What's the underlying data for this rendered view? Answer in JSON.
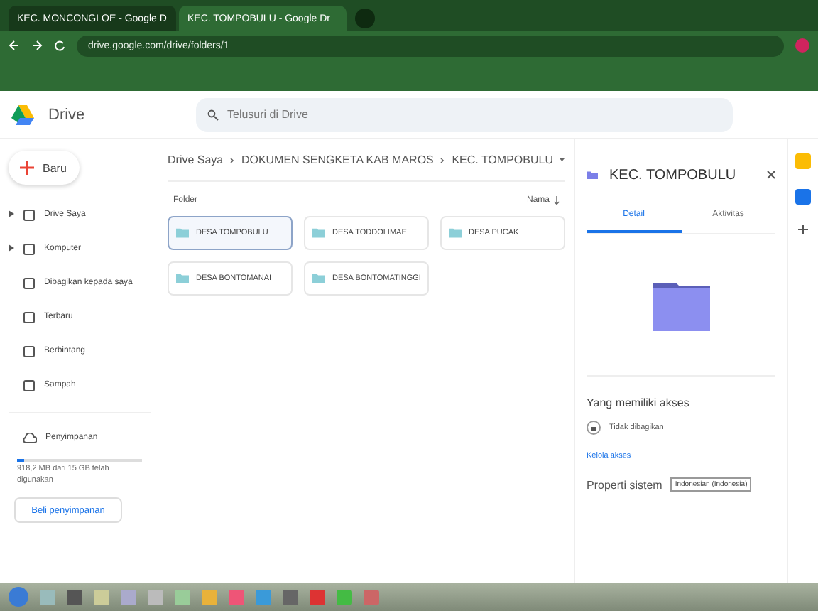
{
  "browser": {
    "tabs": [
      {
        "label": "KEC. MONCONGLOE - Google D",
        "selected": false
      },
      {
        "label": "KEC. TOMPOBULU - Google Dr",
        "selected": true
      }
    ],
    "url": "drive.google.com/drive/folders/1"
  },
  "drive": {
    "brand": "Drive",
    "search": {
      "placeholder": "Telusuri di Drive"
    }
  },
  "sidebar": {
    "new_button": "Baru",
    "items": [
      {
        "label": "Drive Saya",
        "expandable": true
      },
      {
        "label": "Komputer",
        "expandable": true
      },
      {
        "label": "Dibagikan kepada saya",
        "expandable": false
      },
      {
        "label": "Terbaru",
        "expandable": false
      },
      {
        "label": "Berbintang",
        "expandable": false
      },
      {
        "label": "Sampah",
        "expandable": false
      }
    ],
    "storage": {
      "label": "Penyimpanan",
      "level": 0.06,
      "usage": "918,2 MB dari 15 GB telah digunakan",
      "buy": "Beli penyimpanan"
    }
  },
  "breadcrumb": [
    "Drive Saya",
    "DOKUMEN SENGKETA KAB MAROS",
    "KEC. TOMPOBULU"
  ],
  "folders_heading": "Folder",
  "sort": "Nama",
  "folders": [
    {
      "name": "DESA TOMPOBULU",
      "selected": true
    },
    {
      "name": "DESA TODDOLIMAE",
      "selected": false
    },
    {
      "name": "DESA PUCAK",
      "selected": false
    },
    {
      "name": "DESA BONTOMANAI",
      "selected": false
    },
    {
      "name": "DESA BONTOMATINGGI",
      "selected": false
    }
  ],
  "details": {
    "title": "KEC. TOMPOBULU",
    "tabs": [
      {
        "label": "Detail",
        "selected": true
      },
      {
        "label": "Aktivitas",
        "selected": false
      }
    ],
    "access_heading": "Yang memiliki akses",
    "access_status": "Tidak dibagikan",
    "manage": "Kelola akses",
    "system_props": "Properti sistem",
    "language": "Indonesian (Indonesia)"
  }
}
